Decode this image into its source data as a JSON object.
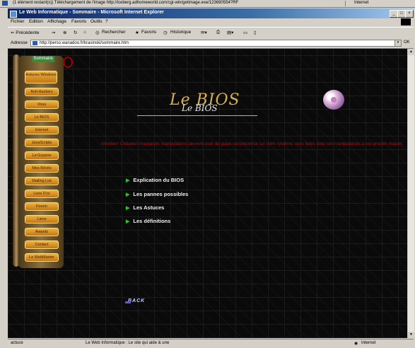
{
  "download_status": "(1 élément restant(s)) Téléchargement de l'image http://iceberg.adhomeworld.com/cgi-win/getimage.exe/123690554?RF",
  "download_zone": "Internet",
  "window": {
    "title": "Le Web Informatique - Sommaire - Microsoft Internet Explorer",
    "minimize": "_",
    "maximize": "□",
    "close": "×"
  },
  "menu": [
    "Fichier",
    "Edition",
    "Affichage",
    "Favoris",
    "Outils",
    "?"
  ],
  "toolbar": {
    "back": "⇐ Précédente",
    "forward": "⇒",
    "stop": "⊗",
    "refresh": "↻",
    "home": "⌂",
    "search": "Rechercher",
    "favorites": "Favoris",
    "history": "Historique"
  },
  "address": {
    "label": "Adresse",
    "url": "http://perso.wanadoo.fr/krasinski/sommaire.htm",
    "go": "OK"
  },
  "sidebar": {
    "tag": "Sommaire",
    "items": [
      "Astuces Windows",
      "Anti-Hackers",
      "Virus",
      "Le BIOS",
      "Internet",
      "JavaScripts",
      "La Guyane",
      "Mes Récits",
      "Mailing List",
      "Livre D'or",
      "Forum",
      "Liens",
      "Awards",
      "Contact",
      "Le WebMaster"
    ]
  },
  "page": {
    "title": "Le BIOS",
    "subtitle": "Le BIOS",
    "warning": "Attention! Certaines mauvaises manipulations peuvent avoir de grave conséquence sur votre système, vous faites donc ces manipulations à vos propres risques",
    "links": [
      "Explication du BIOS",
      "Les pannes possibles",
      "Les Astuces",
      "Les définitions"
    ],
    "back": "BACK"
  },
  "status": {
    "left": "actuce",
    "middle": "Le Web Informatique : Le site qui aide & une",
    "zone": "Internet"
  }
}
